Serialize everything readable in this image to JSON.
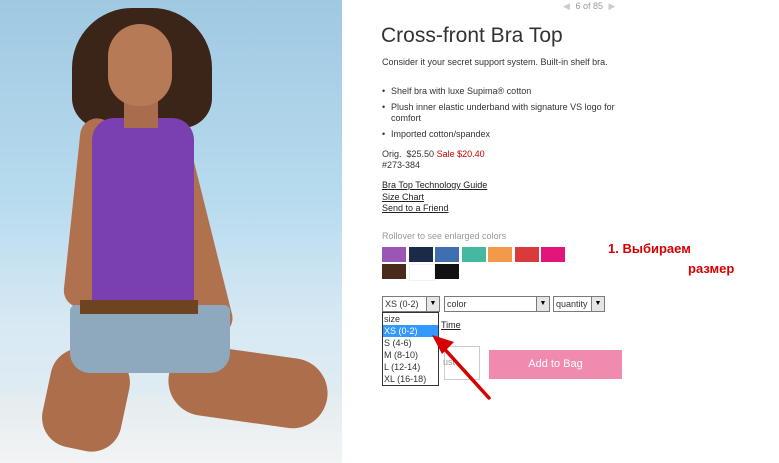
{
  "pager": {
    "prev_icon": "chevron-left-icon",
    "next_icon": "chevron-right-icon",
    "text": "6 of 85"
  },
  "product": {
    "title": "Cross-front Bra Top",
    "description": "Consider it your secret support system. Built-in shelf bra.",
    "bullets": [
      "Shelf bra with luxe Supima® cotton",
      "Plush inner elastic underband with signature VS logo for comfort",
      "Imported cotton/spandex"
    ],
    "orig_label": "Orig.",
    "orig_price": "$25.50",
    "sale_label": "Sale $20.40",
    "sku": "#273-384"
  },
  "links": [
    "Bra Top Technology Guide",
    "Size Chart",
    "Send to a Friend"
  ],
  "rollover_text": "Rollover to see enlarged colors",
  "swatches": [
    "#9b55b5",
    "#1c2a4a",
    "#3f6fb0",
    "#46b8a0",
    "#f39a4a",
    "#d93b3b",
    "#e2167a",
    "#4a2a1a",
    "#ffffff",
    "#111111"
  ],
  "annotation": {
    "line1": "1. Выбираем",
    "line2": "размер",
    "color": "#d60000"
  },
  "selects": {
    "size_value": "XS (0-2)",
    "color_value": "color",
    "quantity_value": "quantity"
  },
  "size_options": [
    "size",
    "XS (0-2)",
    "S (4-6)",
    "M (8-10)",
    "L (12-14)",
    "XL (16-18)"
  ],
  "selected_size_index": 1,
  "time_link_partial": "Time",
  "qty_partial": "ust",
  "add_to_bag": "Add to Bag",
  "colors": {
    "sale": "#cc0000",
    "highlight": "#3399ff",
    "button": "#f08aae"
  }
}
